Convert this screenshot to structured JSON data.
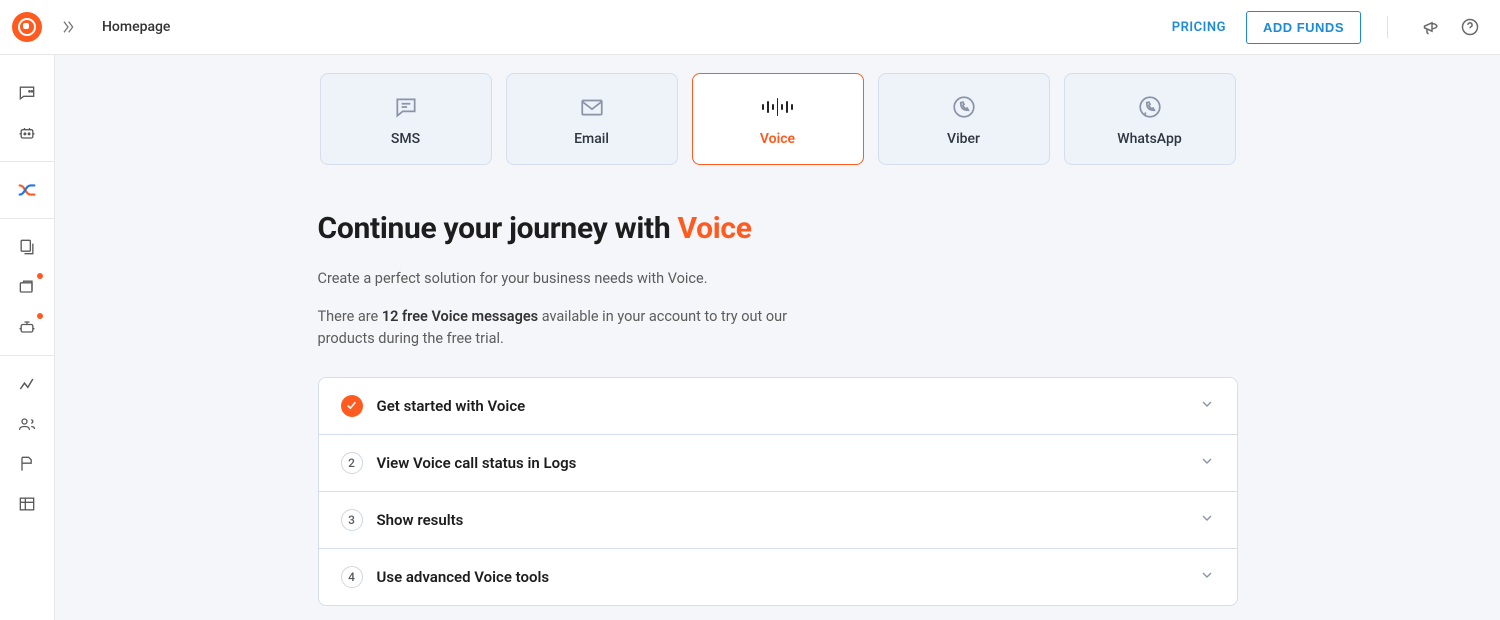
{
  "header": {
    "page_title": "Homepage",
    "pricing_label": "PRICING",
    "add_funds_label": "ADD FUNDS"
  },
  "channels": [
    {
      "id": "sms",
      "label": "SMS"
    },
    {
      "id": "email",
      "label": "Email"
    },
    {
      "id": "voice",
      "label": "Voice",
      "active": true
    },
    {
      "id": "viber",
      "label": "Viber"
    },
    {
      "id": "whatsapp",
      "label": "WhatsApp"
    }
  ],
  "headline_prefix": "Continue your journey with ",
  "headline_accent": "Voice",
  "subtitle": "Create a perfect solution for your business needs with Voice.",
  "freeinfo_prefix": "There are ",
  "freeinfo_bold": "12 free Voice messages",
  "freeinfo_suffix": " available in your account to try out our products during the free trial.",
  "steps": [
    {
      "title": "Get started with Voice",
      "done": true
    },
    {
      "title": "View Voice call status in Logs",
      "num": "2"
    },
    {
      "title": "Show results",
      "num": "3"
    },
    {
      "title": "Use advanced Voice tools",
      "num": "4"
    }
  ]
}
